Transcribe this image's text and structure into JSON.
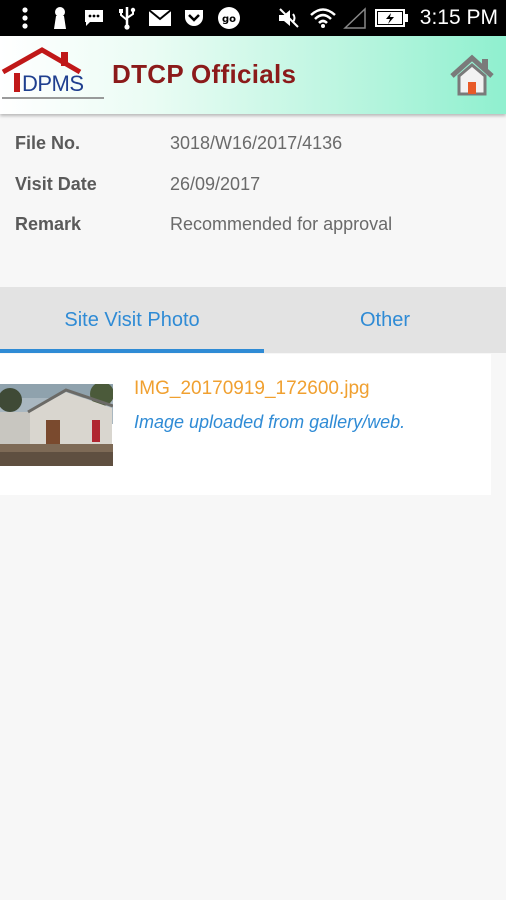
{
  "status_bar": {
    "time": "3:15 PM",
    "icons": [
      "more-vert-icon",
      "keyhole-icon",
      "sms-icon",
      "usb-icon",
      "email-icon",
      "pocket-icon",
      "go-icon",
      "mute-icon",
      "wifi-icon",
      "no-signal-icon",
      "battery-icon"
    ]
  },
  "app_bar": {
    "logo_text": "DPMS",
    "title": "DTCP Officials",
    "home_icon": "home-icon"
  },
  "details": [
    {
      "label": "File No.",
      "value": "3018/W16/2017/4136"
    },
    {
      "label": "Visit Date",
      "value": "26/09/2017"
    },
    {
      "label": "Remark",
      "value": "Recommended for approval"
    }
  ],
  "tabs": [
    {
      "label": "Site Visit Photo",
      "selected": true
    },
    {
      "label": "Other",
      "selected": false
    }
  ],
  "photos": [
    {
      "file_name": "IMG_20170919_172600.jpg",
      "description": "Image uploaded from gallery/web."
    }
  ],
  "colors": {
    "accent": "#2f8bd5",
    "title": "#8b1a1a",
    "file_name": "#f0a030",
    "app_bar_gradient_end": "#8ff0cf"
  }
}
